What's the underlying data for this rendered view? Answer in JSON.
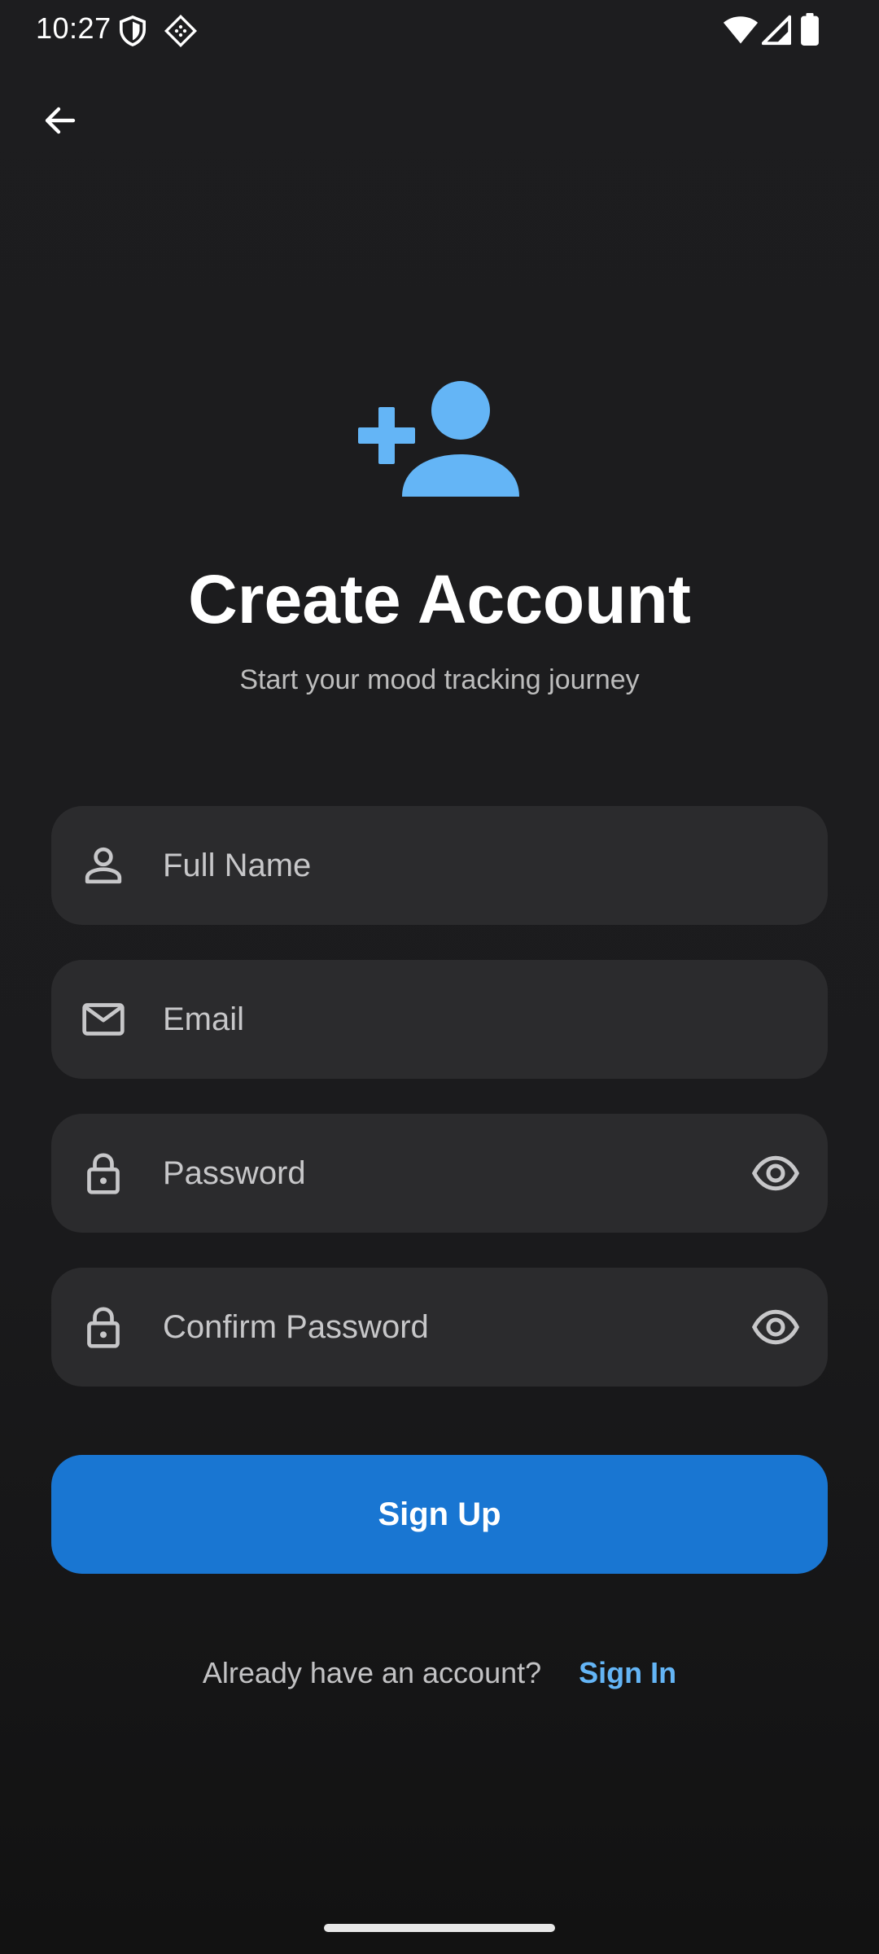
{
  "status_bar": {
    "time": "10:27",
    "icons": [
      "shield-icon",
      "vpn-diamond-icon",
      "wifi-icon",
      "signal-icon",
      "battery-icon"
    ]
  },
  "header": {
    "back_icon": "arrow-back-icon",
    "hero_icon": "person-add-icon",
    "title": "Create Account",
    "subtitle": "Start your mood tracking journey"
  },
  "form": {
    "full_name": {
      "placeholder": "Full Name",
      "value": "",
      "icon": "person-icon"
    },
    "email": {
      "placeholder": "Email",
      "value": "",
      "icon": "mail-icon"
    },
    "password": {
      "placeholder": "Password",
      "value": "",
      "icon": "lock-icon",
      "toggle_icon": "eye-icon"
    },
    "confirm_password": {
      "placeholder": "Confirm Password",
      "value": "",
      "icon": "lock-icon",
      "toggle_icon": "eye-icon"
    },
    "submit_label": "Sign Up"
  },
  "footer": {
    "prompt": "Already have an account?",
    "link_label": "Sign In"
  },
  "colors": {
    "background": "#1c1c1e",
    "field_background": "#2b2b2d",
    "primary": "#1976d2",
    "accent": "#64b5f6",
    "text_secondary": "#bdbdbd"
  }
}
